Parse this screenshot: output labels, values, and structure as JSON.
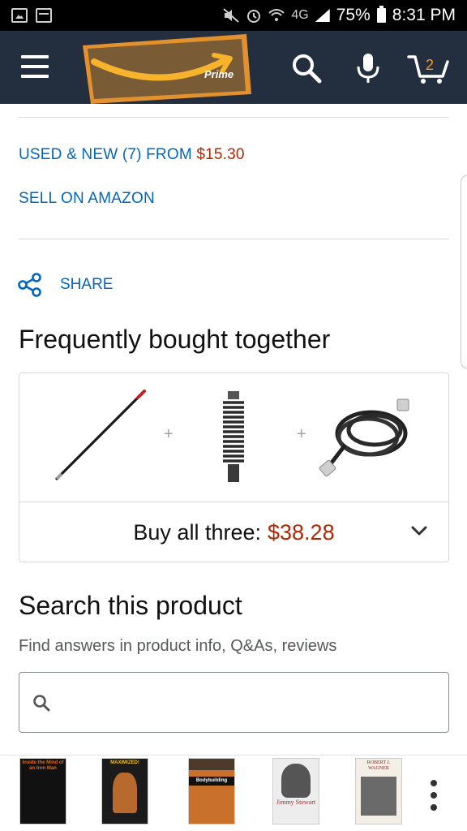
{
  "status_bar": {
    "network_label": "4G",
    "battery": "75%",
    "time": "8:31 PM"
  },
  "nav": {
    "logo_text": "Prime",
    "cart_count": "2"
  },
  "offers": {
    "used_new_label": "USED & NEW (7) FROM ",
    "used_new_price": "$15.30",
    "sell_label": "SELL ON AMAZON"
  },
  "share": {
    "label": "SHARE"
  },
  "fbt": {
    "title": "Frequently bought together",
    "plus_symbol": "+",
    "buy_label": "Buy all three:",
    "buy_price": "$38.28"
  },
  "search_product": {
    "title": "Search this product",
    "subtitle": "Find answers in product info, Q&As, reviews",
    "placeholder": ""
  },
  "bottom_books": [
    {
      "title": "Inside the Mind of an Iron Man"
    },
    {
      "title": "MAXIMIZED!"
    },
    {
      "title": "Bodybuilding"
    },
    {
      "title": "Jimmy Stewart"
    },
    {
      "title": "ROBERT J. WAGNER"
    }
  ],
  "colors": {
    "nav_bg": "#232f3e",
    "link": "#0066c0",
    "price": "#b12704",
    "logo_orange": "#f39a2c"
  }
}
